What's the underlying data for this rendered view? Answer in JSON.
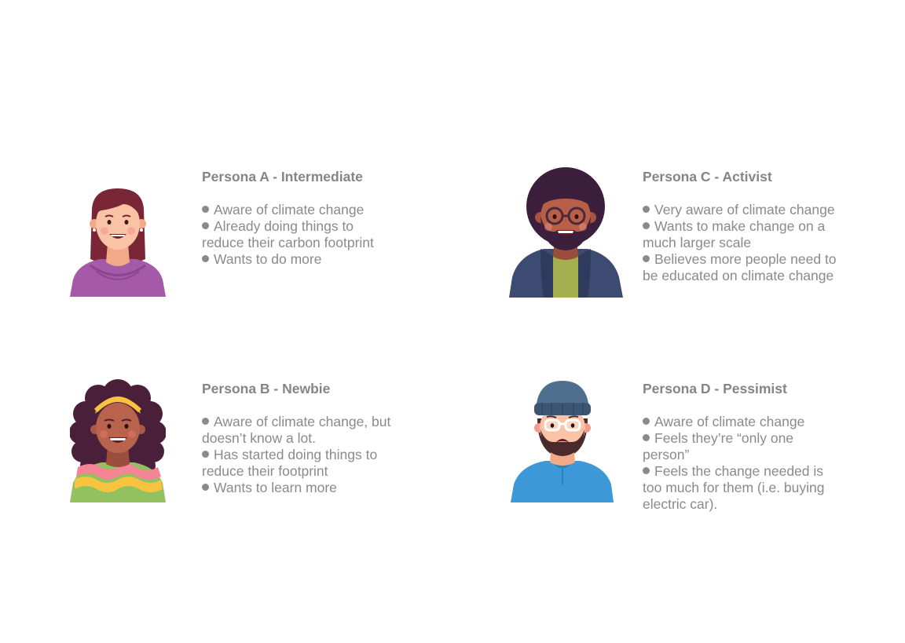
{
  "personas": [
    {
      "title": "Persona A - Intermediate",
      "bullets": [
        "Aware of climate change",
        "Already doing things to reduce their carbon footprint",
        "Wants to do more"
      ]
    },
    {
      "title": "Persona B - Newbie",
      "bullets": [
        "Aware of climate change, but doesn’t know a lot.",
        "Has started doing things to reduce their footprint",
        "Wants to learn more"
      ]
    },
    {
      "title": "Persona C - Activist",
      "bullets": [
        "Very aware of climate change",
        "Wants to make change on a much larger scale",
        "Believes more people need to be educated on climate change"
      ]
    },
    {
      "title": "Persona D - Pessimist",
      "bullets": [
        "Aware of climate change",
        "Feels they’re “only one person”",
        "Feels the change needed is too much for them (i.e. buying electric car)."
      ]
    }
  ]
}
